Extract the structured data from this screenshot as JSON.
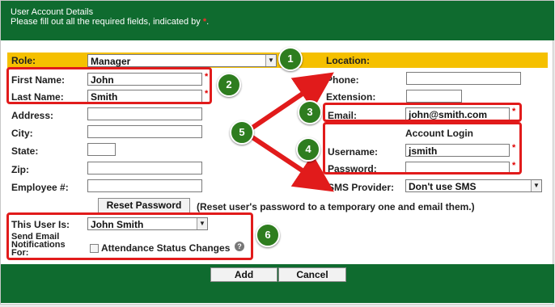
{
  "header": {
    "title": "User Account Details",
    "instruction": "Please fill out all the required fields, indicated by",
    "required_mark": "*",
    "instruction_end": "."
  },
  "form": {
    "role": {
      "label": "Role:",
      "value": "Manager"
    },
    "first_name": {
      "label": "First Name:",
      "value": "John",
      "required": "*"
    },
    "last_name": {
      "label": "Last Name:",
      "value": "Smith",
      "required": "*"
    },
    "address": {
      "label": "Address:",
      "value": ""
    },
    "city": {
      "label": "City:",
      "value": ""
    },
    "state": {
      "label": "State:",
      "value": ""
    },
    "zip": {
      "label": "Zip:",
      "value": ""
    },
    "employee": {
      "label": "Employee #:",
      "value": ""
    },
    "location_heading": "Location:",
    "phone": {
      "label": "Phone:",
      "value": ""
    },
    "extension": {
      "label": "Extension:",
      "value": ""
    },
    "email": {
      "label": "Email:",
      "value": "john@smith.com",
      "required": "*"
    },
    "account_login_heading": "Account Login",
    "username": {
      "label": "Username:",
      "value": "jsmith",
      "required": "*"
    },
    "password": {
      "label": "Password:",
      "value": "",
      "required": "*"
    },
    "sms_provider": {
      "label": "SMS Provider:",
      "value": "Don't use SMS"
    },
    "reset_password_button": "Reset Password",
    "reset_password_note": "(Reset user's password to a temporary one and email them.)",
    "this_user_is": {
      "label": "This User Is:",
      "value": "John Smith"
    },
    "send_email_label_1": "Send Email",
    "send_email_label_2": "Notifications",
    "send_email_label_3": "For:",
    "attendance_checkbox_label": "Attendance Status Changes",
    "attendance_checked": false,
    "help_icon_glyph": "?"
  },
  "actions": {
    "add_label": "Add",
    "cancel_label": "Cancel"
  },
  "callouts": [
    "1",
    "2",
    "3",
    "4",
    "5",
    "6"
  ],
  "colors": {
    "header_bg": "#0f6b2f",
    "role_row_bg": "#f5c000",
    "callout_red": "#e11b1b",
    "badge_green": "#2e7d1f"
  },
  "icons": [
    "chevron-down-icon",
    "help-icon",
    "checkbox-icon",
    "arrow-icon"
  ]
}
